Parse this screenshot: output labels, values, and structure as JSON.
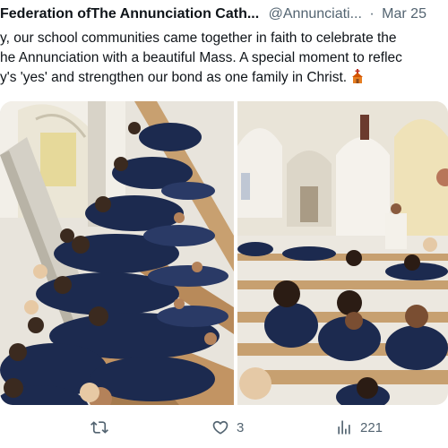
{
  "tweet": {
    "author_name": "Federation ofThe Annunciation Cath...",
    "handle": "@Annunciati...",
    "separator": "·",
    "date": "Mar 25",
    "text_lines": [
      "y, our school communities came together in faith to celebrate the",
      "he Annunciation with a beautiful Mass.  A special moment to reflec",
      "y's 'yes' and strengthen our bond as one family in Christ."
    ],
    "emoji": "church-emoji"
  },
  "media": {
    "left_photo": "students-seated-in-pews-photo",
    "right_photo": "church-mass-interior-photo"
  },
  "actions": {
    "retweets": "",
    "likes": "3",
    "views": "221"
  },
  "colors": {
    "text": "#0f1419",
    "muted": "#536471",
    "uniform": "#1c2a4f",
    "wood": "#c8a070"
  }
}
